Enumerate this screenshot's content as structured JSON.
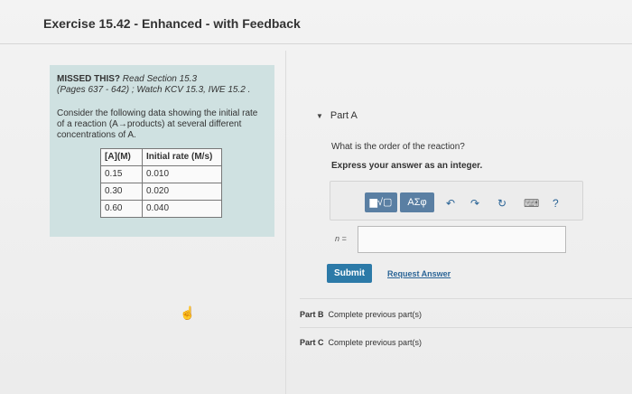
{
  "header": {
    "title": "Exercise 15.42 - Enhanced - with Feedback"
  },
  "info": {
    "missed_label": "MISSED THIS?",
    "read": " Read Section 15.3",
    "pages": "(Pages 637 - 642) ; Watch KCV 15.3, IWE 15.2 .",
    "consider": "Consider the following data showing the initial rate of a reaction (A→products) at several different concentrations of A."
  },
  "table": {
    "headers": [
      "[A](M)",
      "Initial rate (M/s)"
    ],
    "rows": [
      [
        "0.15",
        "0.010"
      ],
      [
        "0.30",
        "0.020"
      ],
      [
        "0.60",
        "0.040"
      ]
    ]
  },
  "partA": {
    "label": "Part A",
    "question": "What is the order of the reaction?",
    "express": "Express your answer as an integer.",
    "var_label": "n =",
    "answer_value": "",
    "submit": "Submit",
    "request": "Request Answer"
  },
  "toolbar": {
    "template_btn": "▆√▢",
    "greek_btn": "ΑΣφ",
    "undo": "↶",
    "redo": "↷",
    "reset": "↻",
    "keyboard": "⌨",
    "help": "?"
  },
  "partB": {
    "label": "Part B",
    "status": "Complete previous part(s)"
  },
  "partC": {
    "label": "Part C",
    "status": "Complete previous part(s)"
  }
}
